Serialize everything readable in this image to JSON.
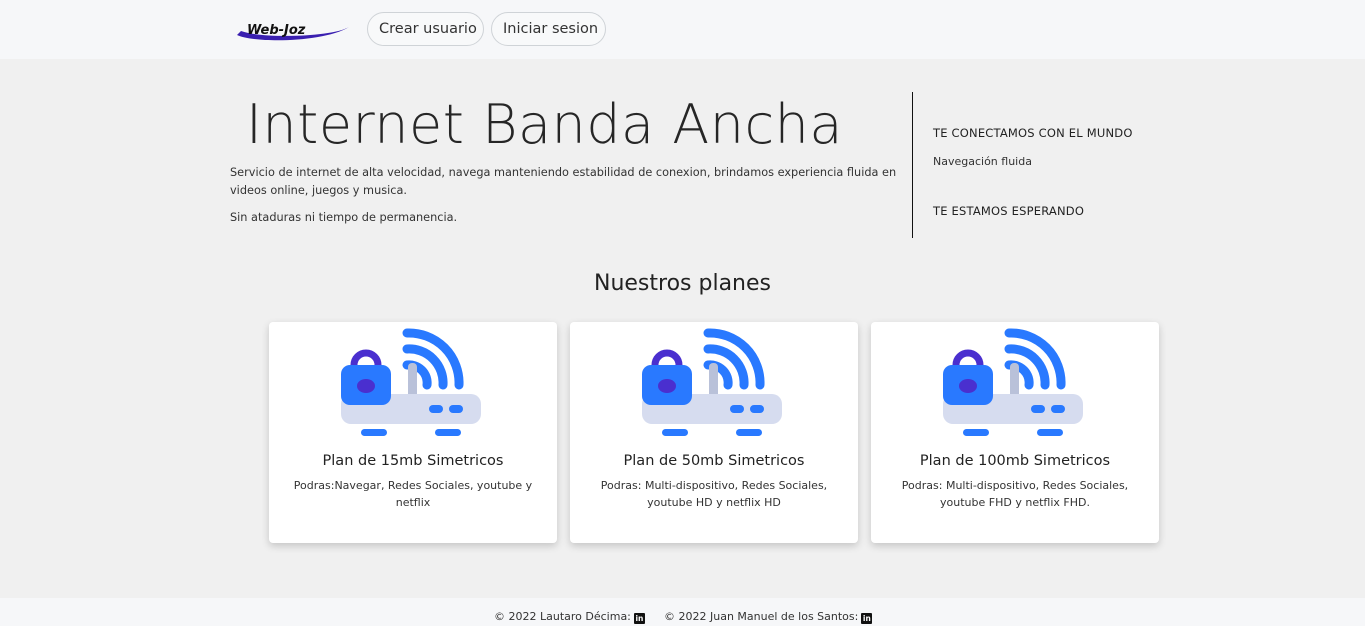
{
  "header": {
    "logo_text": "Web-Joz",
    "buttons": {
      "crear_usuario": "Crear usuario",
      "iniciar_sesion": "Iniciar sesion"
    }
  },
  "hero": {
    "title": "Internet Banda Ancha",
    "description": "Servicio de internet de alta velocidad, navega manteniendo estabilidad de conexion, brindamos experiencia fluida en videos online, juegos y musica.",
    "note": "Sin ataduras ni tiempo de permanencia."
  },
  "aside": {
    "heading1": "TE CONECTAMOS CON EL MUNDO",
    "text1": "Navegación fluida",
    "heading2": "TE ESTAMOS ESPERANDO"
  },
  "plans": {
    "title": "Nuestros planes",
    "items": [
      {
        "title": "Plan de 15mb Simetricos",
        "description": "Podras:Navegar, Redes Sociales, youtube y netflix",
        "icon": "router-wifi-lock-icon"
      },
      {
        "title": "Plan de 50mb Simetricos",
        "description": "Podras: Multi-dispositivo, Redes Sociales, youtube HD y netflix HD",
        "icon": "router-wifi-lock-icon"
      },
      {
        "title": "Plan de 100mb Simetricos",
        "description": "Podras: Multi-dispositivo, Redes Sociales, youtube FHD y netflix FHD.",
        "icon": "router-wifi-lock-icon"
      }
    ]
  },
  "footer": {
    "credit1": "© 2022 Lautaro Décima:",
    "credit2": "© 2022 Juan Manuel de los Santos:",
    "linkedin_glyph": "in"
  },
  "colors": {
    "router_blue": "#2979ff",
    "lock_purple": "#4a2fcf",
    "router_body": "#d6dcef",
    "logo_purple": "#3a1fb0"
  }
}
